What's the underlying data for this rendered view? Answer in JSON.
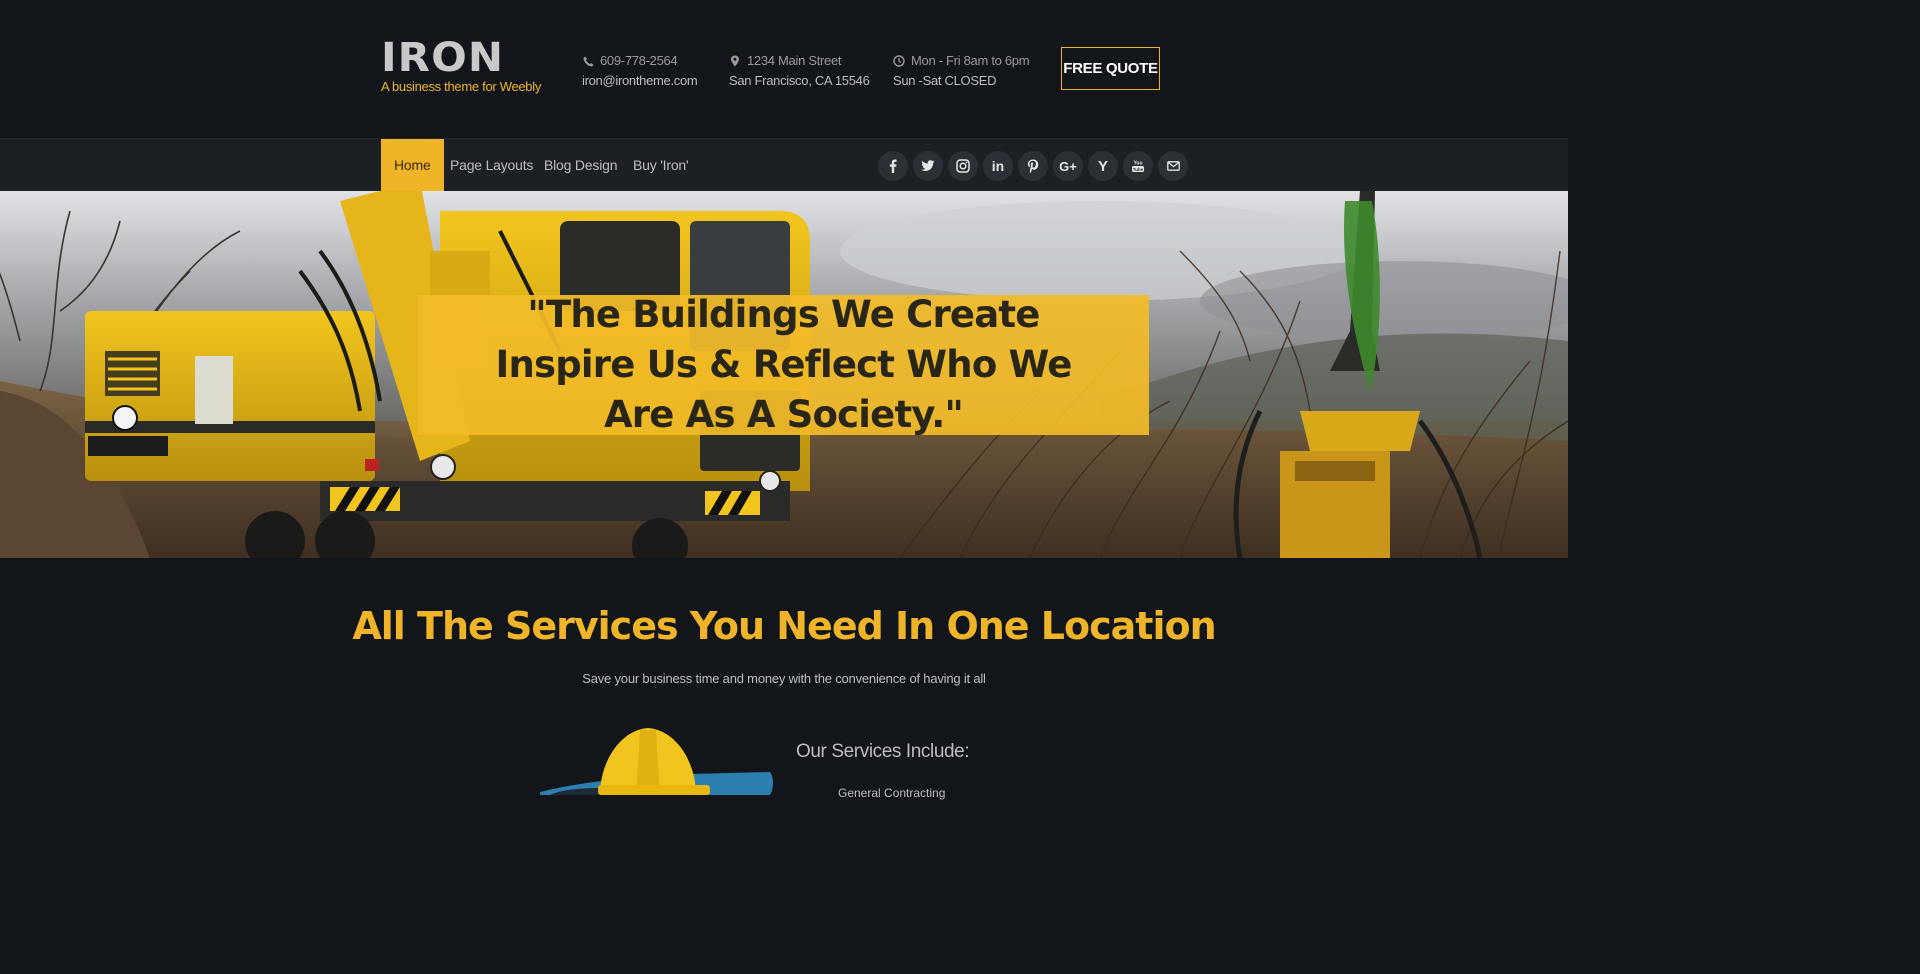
{
  "brand": {
    "name": "IRON",
    "tagline": "A business theme for Weebly"
  },
  "contact": {
    "phone": "609-778-2564",
    "email": "iron@irontheme.com",
    "address_line1": "1234 Main Street",
    "address_line2": "San Francisco, CA 15546",
    "hours_line1": "Mon - Fri 8am to 6pm",
    "hours_line2": "Sun -Sat CLOSED",
    "icons": [
      "phone-icon",
      "map-pin-icon",
      "clock-icon"
    ]
  },
  "quote_button": "FREE QUOTE",
  "nav": {
    "items": [
      {
        "label": "Home",
        "active": true
      },
      {
        "label": "Page Layouts",
        "active": false
      },
      {
        "label": "Blog Design",
        "active": false
      },
      {
        "label": "Buy 'Iron'",
        "active": false
      }
    ]
  },
  "social": [
    {
      "name": "facebook-icon",
      "glyph": "f"
    },
    {
      "name": "twitter-icon",
      "glyph": ""
    },
    {
      "name": "instagram-icon",
      "glyph": ""
    },
    {
      "name": "linkedin-icon",
      "glyph": "in"
    },
    {
      "name": "pinterest-icon",
      "glyph": "P"
    },
    {
      "name": "google-plus-icon",
      "glyph": "G+"
    },
    {
      "name": "yelp-icon",
      "glyph": "Y"
    },
    {
      "name": "youtube-icon",
      "glyph": "You"
    },
    {
      "name": "mail-icon",
      "glyph": ""
    }
  ],
  "hero": {
    "quote": "\"The Buildings We Create Inspire Us & Reflect Who We Are As A Society.\""
  },
  "services": {
    "title": "All The Services You Need In One Location",
    "subtitle": "Save your business time and money with the convenience of having it all",
    "include_heading": "Our Services Include:",
    "first_item": "General Contracting"
  },
  "colors": {
    "accent": "#f0b429",
    "background": "#12161b",
    "nav_background": "#1c2025"
  }
}
